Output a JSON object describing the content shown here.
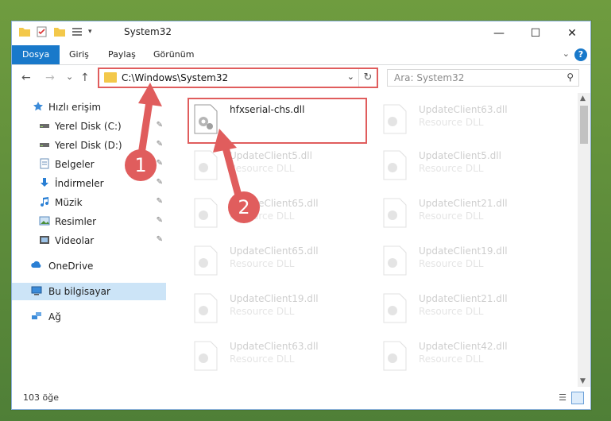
{
  "window": {
    "title": "System32",
    "min_glyph": "—",
    "max_glyph": "☐",
    "close_glyph": "✕"
  },
  "ribbon": {
    "tabs": [
      {
        "label": "Dosya",
        "active": true
      },
      {
        "label": "Giriş"
      },
      {
        "label": "Paylaş"
      },
      {
        "label": "Görünüm"
      }
    ],
    "help": "?",
    "expand": "⌄"
  },
  "nav": {
    "back": "←",
    "forward": "→",
    "recent": "⌄",
    "up": "↑"
  },
  "address": {
    "path": "C:\\Windows\\System32",
    "dropdown": "⌄",
    "refresh": "↻"
  },
  "search": {
    "placeholder": "Ara: System32",
    "icon": "⚲"
  },
  "sidebar": {
    "items": [
      {
        "label": "Hızlı erişim",
        "icon": "star-icon"
      },
      {
        "label": "Yerel Disk (C:)",
        "icon": "drive-icon",
        "pinned": true
      },
      {
        "label": "Yerel Disk (D:)",
        "icon": "drive-icon",
        "pinned": true
      },
      {
        "label": "Belgeler",
        "icon": "documents-icon",
        "pinned": true
      },
      {
        "label": "İndirmeler",
        "icon": "download-icon",
        "pinned": true
      },
      {
        "label": "Müzik",
        "icon": "music-icon",
        "pinned": true
      },
      {
        "label": "Resimler",
        "icon": "pictures-icon",
        "pinned": true
      },
      {
        "label": "Videolar",
        "icon": "videos-icon",
        "pinned": true
      },
      {
        "label": "OneDrive",
        "icon": "cloud-icon"
      },
      {
        "label": "Bu bilgisayar",
        "icon": "computer-icon",
        "selected": true
      },
      {
        "label": "Ağ",
        "icon": "network-icon"
      }
    ],
    "pin_glyph": "📌"
  },
  "files": {
    "highlighted": {
      "name": "hfxserial-chs.dll",
      "type": ""
    },
    "left": [
      {
        "name": "UpdateClient5.dll",
        "type": "Resource DLL"
      },
      {
        "name": "UpdateClient65.dll",
        "type": "Resource DLL"
      },
      {
        "name": "UpdateClient65.dll",
        "type": "Resource DLL"
      },
      {
        "name": "UpdateClient19.dll",
        "type": "Resource DLL"
      },
      {
        "name": "UpdateClient63.dll",
        "type": "Resource DLL"
      }
    ],
    "right": [
      {
        "name": "UpdateClient63.dll",
        "type": "Resource DLL"
      },
      {
        "name": "UpdateClient5.dll",
        "type": "Resource DLL"
      },
      {
        "name": "UpdateClient21.dll",
        "type": "Resource DLL"
      },
      {
        "name": "UpdateClient19.dll",
        "type": "Resource DLL"
      },
      {
        "name": "UpdateClient21.dll",
        "type": "Resource DLL"
      },
      {
        "name": "UpdateClient42.dll",
        "type": "Resource DLL"
      }
    ]
  },
  "status": {
    "count": "103 öğe"
  },
  "callouts": {
    "one": "1",
    "two": "2"
  },
  "colors": {
    "accent": "#1979ca",
    "highlight": "#e05d5d",
    "selection": "#cce4f7"
  }
}
